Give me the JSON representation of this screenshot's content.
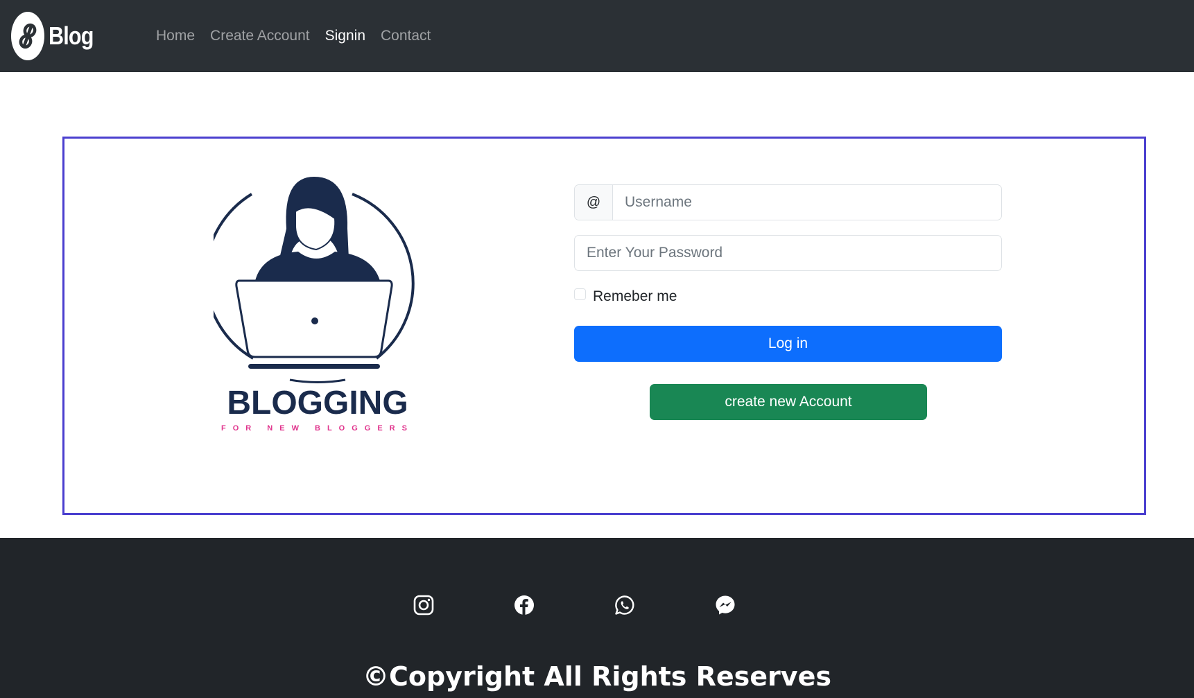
{
  "brand": {
    "name": "Blog"
  },
  "nav": {
    "items": [
      {
        "label": "Home"
      },
      {
        "label": "Create Account"
      },
      {
        "label": "Signin"
      },
      {
        "label": "Contact"
      }
    ],
    "active": "Signin"
  },
  "illustration": {
    "title": "BLOGGING",
    "tagline": "FOR NEW BLOGGERS",
    "title_color": "#1a2b4c",
    "tagline_color": "#e0338c"
  },
  "login_form": {
    "username_addon": "@",
    "username_placeholder": "Username",
    "password_placeholder": "Enter Your Password",
    "remember_label": "Remeber me",
    "remember_checked": false,
    "login_button": "Log in",
    "create_button": "create new Account"
  },
  "footer": {
    "social_icons": [
      "instagram-icon",
      "facebook-icon",
      "whatsapp-icon",
      "messenger-icon"
    ],
    "copyright": "©Copyright All Rights Reserves"
  },
  "colors": {
    "navbar_bg": "#2b3035",
    "footer_bg": "#212529",
    "card_border": "#4a3fcf",
    "primary": "#0d6efd",
    "success": "#198754"
  }
}
